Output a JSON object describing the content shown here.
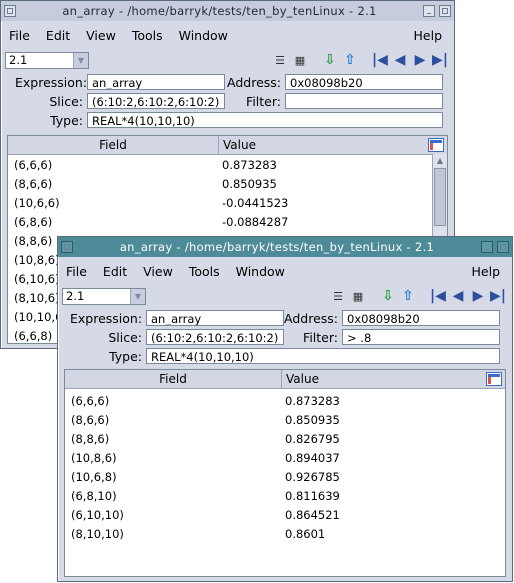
{
  "back_window": {
    "title": "an_array - /home/barryk/tests/ten_by_tenLinux - 2.1",
    "menus": [
      "File",
      "Edit",
      "View",
      "Tools",
      "Window",
      "Help"
    ],
    "thread_combo": "2.1",
    "labels": {
      "expression": "Expression:",
      "address": "Address:",
      "slice": "Slice:",
      "filter": "Filter:",
      "type": "Type:"
    },
    "expression": "an_array",
    "address": "0x08098b20",
    "slice": "(6:10:2,6:10:2,6:10:2)",
    "filter": "",
    "type": "REAL*4(10,10,10)",
    "columns": {
      "field": "Field",
      "value": "Value"
    },
    "rows": [
      {
        "field": "(6,6,6)",
        "value": "0.873283"
      },
      {
        "field": "(8,6,6)",
        "value": "0.850935"
      },
      {
        "field": "(10,6,6)",
        "value": "-0.0441523"
      },
      {
        "field": "(6,8,6)",
        "value": "-0.0884287"
      },
      {
        "field": "(8,8,6)",
        "value": ""
      },
      {
        "field": "(10,8,6)",
        "value": ""
      },
      {
        "field": "(6,10,6)",
        "value": ""
      },
      {
        "field": "(8,10,6)",
        "value": ""
      },
      {
        "field": "(10,10,6)",
        "value": ""
      },
      {
        "field": "(6,6,8)",
        "value": ""
      }
    ]
  },
  "front_window": {
    "title": "an_array - /home/barryk/tests/ten_by_tenLinux - 2.1",
    "menus": [
      "File",
      "Edit",
      "View",
      "Tools",
      "Window",
      "Help"
    ],
    "thread_combo": "2.1",
    "labels": {
      "expression": "Expression:",
      "address": "Address:",
      "slice": "Slice:",
      "filter": "Filter:",
      "type": "Type:"
    },
    "expression": "an_array",
    "address": "0x08098b20",
    "slice": "(6:10:2,6:10:2,6:10:2)",
    "filter": "> .8",
    "type": "REAL*4(10,10,10)",
    "columns": {
      "field": "Field",
      "value": "Value"
    },
    "rows": [
      {
        "field": "(6,6,6)",
        "value": "0.873283"
      },
      {
        "field": "(8,6,6)",
        "value": "0.850935"
      },
      {
        "field": "(8,8,6)",
        "value": "0.826795"
      },
      {
        "field": "(10,8,6)",
        "value": "0.894037"
      },
      {
        "field": "(10,6,8)",
        "value": "0.926785"
      },
      {
        "field": "(6,8,10)",
        "value": "0.811639"
      },
      {
        "field": "(6,10,10)",
        "value": "0.864521"
      },
      {
        "field": "(8,10,10)",
        "value": "0.8601"
      }
    ]
  },
  "icons": {
    "window_buttons": [
      "close-icon",
      "minimize-icon",
      "maximize-icon"
    ],
    "toolbar": [
      "list-view-icon",
      "grid-view-icon",
      "dive-icon",
      "undive-icon",
      "first-icon",
      "previous-icon",
      "next-icon",
      "last-icon"
    ],
    "column_chooser": "column-chooser-icon"
  },
  "colors": {
    "front_titlebar": "#4d8b98",
    "back_titlebar": "#c6cbdd",
    "window_bg": "#d6d9e6",
    "nav_arrows": "#2d4fa0"
  }
}
